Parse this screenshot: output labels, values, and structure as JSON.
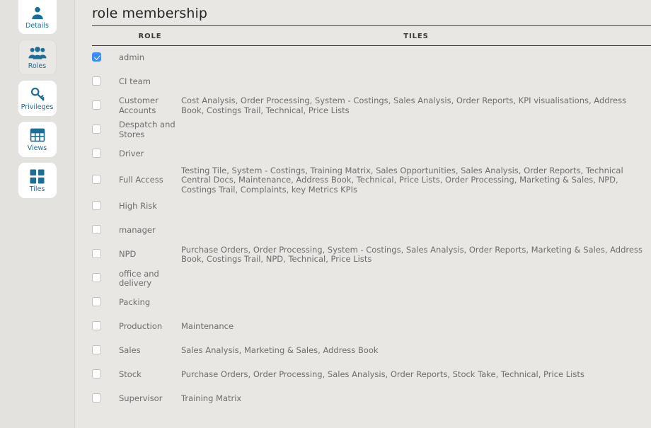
{
  "sidebar": {
    "items": [
      {
        "label": "Details",
        "icon": "user-icon",
        "active": false
      },
      {
        "label": "Roles",
        "icon": "users-icon",
        "active": true
      },
      {
        "label": "Privileges",
        "icon": "key-icon",
        "active": false
      },
      {
        "label": "Views",
        "icon": "table-icon",
        "active": false
      },
      {
        "label": "Tiles",
        "icon": "grid-squares-icon",
        "active": false
      }
    ]
  },
  "main": {
    "title": "role membership",
    "columns": {
      "check": "",
      "role": "ROLE",
      "tiles": "TILES"
    },
    "rows": [
      {
        "checked": true,
        "role": "admin",
        "tiles": ""
      },
      {
        "checked": false,
        "role": "CI team",
        "tiles": ""
      },
      {
        "checked": false,
        "role": "Customer Accounts",
        "tiles": "Cost Analysis, Order Processing, System - Costings, Sales Analysis, Order Reports, KPI visualisations, Address Book, Costings Trail, Technical, Price Lists"
      },
      {
        "checked": false,
        "role": "Despatch and Stores",
        "tiles": ""
      },
      {
        "checked": false,
        "role": "Driver",
        "tiles": ""
      },
      {
        "checked": false,
        "role": "Full Access",
        "tiles": "Testing Tile, System - Costings, Training Matrix, Sales Opportunities, Sales Analysis, Order Reports, Technical Central Docs, Maintenance, Address Book, Technical, Price Lists, Order Processing, Marketing & Sales, NPD, Costings Trail, Complaints, key Metrics KPIs"
      },
      {
        "checked": false,
        "role": "High Risk",
        "tiles": ""
      },
      {
        "checked": false,
        "role": "manager",
        "tiles": ""
      },
      {
        "checked": false,
        "role": "NPD",
        "tiles": "Purchase Orders, Order Processing, System - Costings, Sales Analysis, Order Reports, Marketing & Sales, Address Book, Costings Trail, NPD, Technical, Price Lists"
      },
      {
        "checked": false,
        "role": "office and delivery",
        "tiles": ""
      },
      {
        "checked": false,
        "role": "Packing",
        "tiles": ""
      },
      {
        "checked": false,
        "role": "Production",
        "tiles": "Maintenance"
      },
      {
        "checked": false,
        "role": "Sales",
        "tiles": "Sales Analysis, Marketing & Sales, Address Book"
      },
      {
        "checked": false,
        "role": "Stock",
        "tiles": "Purchase Orders, Order Processing, Sales Analysis, Order Reports, Stock Take, Technical, Price Lists"
      },
      {
        "checked": false,
        "role": "Supervisor",
        "tiles": "Training Matrix"
      }
    ]
  },
  "colors": {
    "accent": "#1d6e96",
    "checkbox_checked": "#3c8dfb",
    "background": "#e8e7e3",
    "sidebar_background": "#e3e2de",
    "text": "#6d6d6d",
    "heading": "#3a3a3a"
  }
}
